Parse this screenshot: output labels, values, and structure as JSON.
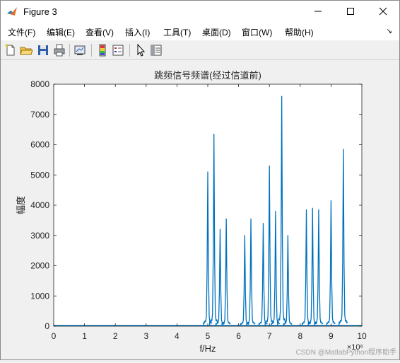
{
  "window": {
    "title": "Figure 3"
  },
  "menu": [
    "文件(F)",
    "编辑(E)",
    "查看(V)",
    "插入(I)",
    "工具(T)",
    "桌面(D)",
    "窗口(W)",
    "帮助(H)"
  ],
  "toolbar": {
    "buttons": [
      "new-figure",
      "open-file",
      "save",
      "print",
      "link-plot",
      "insert-colorbar",
      "insert-legend",
      "edit-plot",
      "property-inspector"
    ]
  },
  "chart_data": {
    "type": "line",
    "title": "跳频信号频谱(经过信道前)",
    "xlabel": "f/Hz",
    "ylabel": "幅度",
    "x_exponent": "×10⁶",
    "xlim": [
      0,
      10
    ],
    "ylim": [
      0,
      8000
    ],
    "xticks": [
      0,
      1,
      2,
      3,
      4,
      5,
      6,
      7,
      8,
      9,
      10
    ],
    "yticks": [
      0,
      1000,
      2000,
      3000,
      4000,
      5000,
      6000,
      7000,
      8000
    ],
    "color": "#0072bd",
    "peaks": [
      {
        "x": 5.0,
        "y": 5100
      },
      {
        "x": 5.2,
        "y": 6350
      },
      {
        "x": 5.4,
        "y": 3200
      },
      {
        "x": 5.6,
        "y": 3550
      },
      {
        "x": 6.2,
        "y": 3000
      },
      {
        "x": 6.4,
        "y": 3550
      },
      {
        "x": 6.8,
        "y": 3400
      },
      {
        "x": 7.0,
        "y": 5300
      },
      {
        "x": 7.2,
        "y": 3800
      },
      {
        "x": 7.4,
        "y": 7600
      },
      {
        "x": 7.6,
        "y": 3000
      },
      {
        "x": 8.2,
        "y": 3850
      },
      {
        "x": 8.4,
        "y": 3900
      },
      {
        "x": 8.6,
        "y": 3850
      },
      {
        "x": 9.0,
        "y": 4150
      },
      {
        "x": 9.4,
        "y": 5850
      }
    ]
  },
  "watermark": "CSDN @MatlabPython程序助手"
}
